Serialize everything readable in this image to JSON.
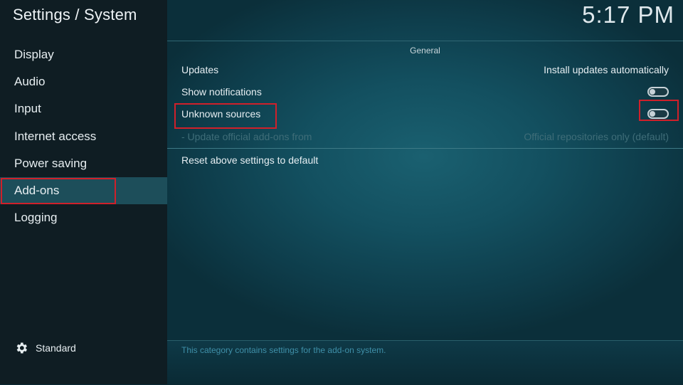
{
  "header": {
    "title": "Settings / System",
    "clock": "5:17 PM"
  },
  "sidebar": {
    "items": [
      {
        "label": "Display"
      },
      {
        "label": "Audio"
      },
      {
        "label": "Input"
      },
      {
        "label": "Internet access"
      },
      {
        "label": "Power saving"
      },
      {
        "label": "Add-ons",
        "active": true
      },
      {
        "label": "Logging"
      }
    ],
    "level": {
      "icon": "gear-icon",
      "label": "Standard"
    }
  },
  "main": {
    "group_title": "General",
    "settings": [
      {
        "label": "Updates",
        "value": "Install updates automatically"
      },
      {
        "label": "Show notifications",
        "type": "toggle",
        "state": "off"
      },
      {
        "label": "Unknown sources",
        "type": "toggle",
        "state": "off"
      },
      {
        "label": "- Update official add-ons from",
        "value": "Official repositories only (default)",
        "disabled": true
      }
    ],
    "reset_label": "Reset above settings to default",
    "description": "This category contains settings for the add-on system."
  },
  "colors": {
    "highlight": "#d0202a",
    "active_item": "#1d4e5a",
    "sidebar_bg": "#0f1d23",
    "description_text": "#3f8fa8"
  }
}
